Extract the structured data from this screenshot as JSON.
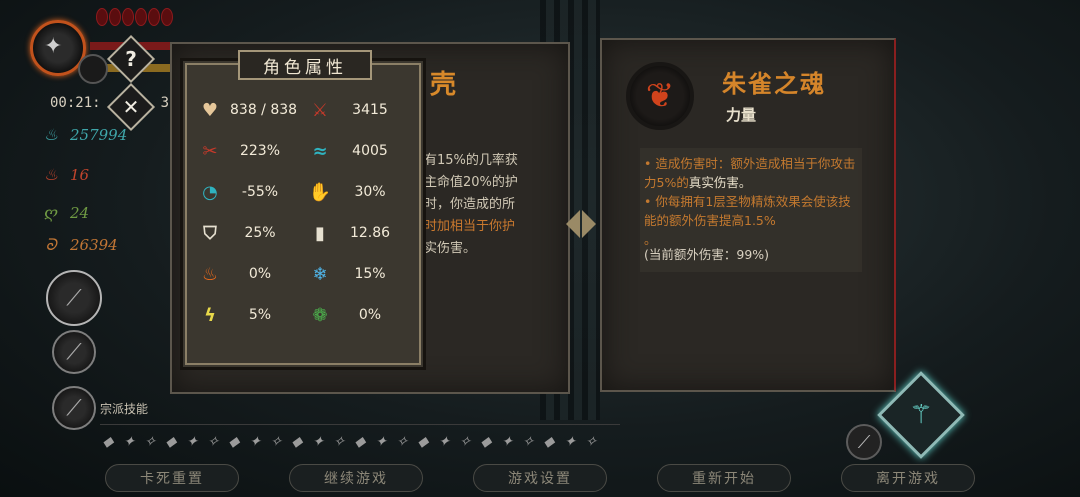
{
  "hud": {
    "timer": "00:21:",
    "timer_tail": "3",
    "help_glyph": "?",
    "close_glyph": "✕",
    "resources": [
      {
        "icon": "blue-soul-icon",
        "glyph": "♨",
        "color": "#3fa6a9",
        "value": "257994"
      },
      {
        "icon": "red-flame-icon",
        "glyph": "♨",
        "color": "#c2452d",
        "value": "16"
      },
      {
        "icon": "green-leaf-icon",
        "glyph": "ღ",
        "color": "#6f9a43",
        "value": "24"
      },
      {
        "icon": "orange-coin-icon",
        "glyph": "ᘐ",
        "color": "#c27635",
        "value": "26394"
      }
    ],
    "sect_label": "宗派技能"
  },
  "attributes": {
    "title": "角色属性",
    "stats": [
      {
        "icon": "heart-icon",
        "glyph": "♥",
        "color": "#e6c79a",
        "value": "838 / 838"
      },
      {
        "icon": "attack-sword-icon",
        "glyph": "⚔",
        "color": "#c5392a",
        "value": "3415"
      },
      {
        "icon": "crit-claw-icon",
        "glyph": "✂",
        "color": "#c5392a",
        "value": "223%"
      },
      {
        "icon": "speed-dragon-icon",
        "glyph": "≈",
        "color": "#2fb3c0",
        "value": "4005"
      },
      {
        "icon": "cooldown-icon",
        "glyph": "◔",
        "color": "#2fb3c0",
        "value": "-55%"
      },
      {
        "icon": "damage-reduction-icon",
        "glyph": "✋",
        "color": "#e6c79a",
        "value": "30%"
      },
      {
        "icon": "shield-icon",
        "glyph": "⛉",
        "color": "#e6e0d0",
        "value": "25%"
      },
      {
        "icon": "gold-stack-icon",
        "glyph": "▮",
        "color": "#e6e0d0",
        "value": "12.86"
      },
      {
        "icon": "fire-icon",
        "glyph": "♨",
        "color": "#e86a1c",
        "value": "0%"
      },
      {
        "icon": "ice-icon",
        "glyph": "❄",
        "color": "#4fb4e8",
        "value": "15%"
      },
      {
        "icon": "lightning-icon",
        "glyph": "ϟ",
        "color": "#e8d94a",
        "value": "5%"
      },
      {
        "icon": "poison-icon",
        "glyph": "❁",
        "color": "#4caf4c",
        "value": "0%"
      }
    ]
  },
  "middle_panel": {
    "title_fragment": "壳",
    "desc_lines": [
      "有15%的几率获",
      "主命值20%的护",
      "",
      "时，你造成的所",
      "时加相当于你护",
      "实伤害。"
    ]
  },
  "item": {
    "name": "朱雀之魂",
    "type": "力量",
    "desc_1": "• 造成伤害时：额外造成相当于你攻击力5%的",
    "desc_1_white": "真实伤害。",
    "desc_2": "• 你每拥有1层圣物精炼效果会使该技能的额外伤害提高1.5%",
    "desc_2_tail": "。",
    "current": "(当前额外伤害：99%)"
  },
  "menu": {
    "buttons": [
      "卡死重置",
      "继续游戏",
      "游戏设置",
      "重新开始",
      "离开游戏"
    ]
  }
}
